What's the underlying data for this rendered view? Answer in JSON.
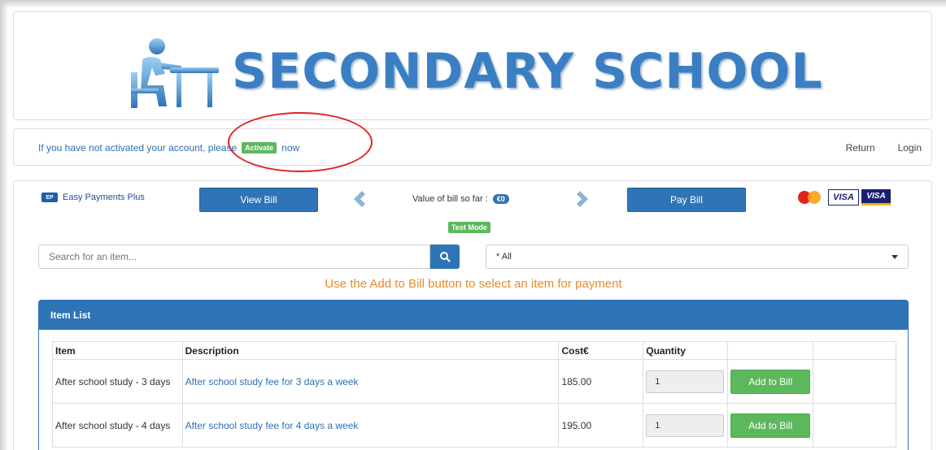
{
  "header": {
    "school_name": "SECONDARY SCHOOL",
    "logo_icon": "student-at-desk-icon"
  },
  "notice": {
    "text_before": "If you have not activated your account, please",
    "activate_badge": "Activate",
    "text_after": "now"
  },
  "nav": {
    "return_label": "Return",
    "login_label": "Login"
  },
  "toolbar": {
    "provider_name": "Easy Payments Plus",
    "provider_badge": "EP",
    "view_bill_label": "View Bill",
    "bill_value_label": "Value of bill so far :",
    "bill_value": "€0",
    "pay_bill_label": "Pay Bill",
    "test_mode_label": "Test Mode",
    "card_brands": [
      "mastercard",
      "visa",
      "visa-electron"
    ],
    "visa_text": "VISA"
  },
  "search": {
    "placeholder": "Search for an item...",
    "category_selected": "* All"
  },
  "hint": "Use the Add to Bill button to select an item for payment",
  "item_list": {
    "title": "Item List",
    "columns": [
      "Item",
      "Description",
      "Cost€",
      "Quantity"
    ],
    "rows": [
      {
        "item": "After school study - 3 days",
        "description": "After school study fee for 3 days a week",
        "cost": "185.00",
        "quantity": "1",
        "action": "Add to Bill"
      },
      {
        "item": "After school study - 4 days",
        "description": "After school study fee for 4 days a week",
        "cost": "195.00",
        "quantity": "1",
        "action": "Add to Bill"
      }
    ]
  },
  "colors": {
    "primary": "#2f74b7",
    "success": "#5cb85c",
    "hint": "#e88a2a",
    "annotation": "#e02020"
  }
}
